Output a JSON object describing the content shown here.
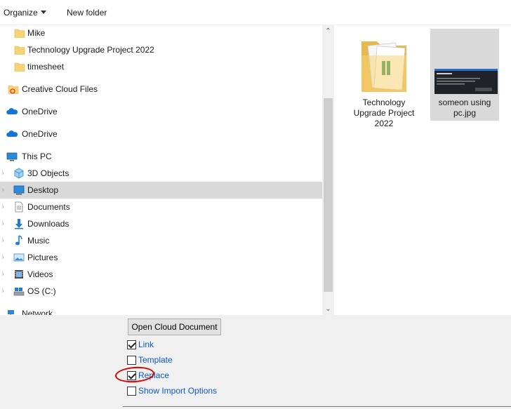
{
  "toolbar": {
    "organize_label": "Organize",
    "new_folder_label": "New folder"
  },
  "nav": {
    "items": [
      {
        "label": "Mike",
        "icon": "folder-icon"
      },
      {
        "label": "Technology Upgrade Project 2022",
        "icon": "folder-icon"
      },
      {
        "label": "timesheet",
        "icon": "folder-icon"
      },
      {
        "label": "Creative Cloud Files",
        "icon": "creative-cloud-icon"
      },
      {
        "label": "OneDrive",
        "icon": "onedrive-icon"
      },
      {
        "label": "OneDrive",
        "icon": "onedrive-icon"
      },
      {
        "label": "This PC",
        "icon": "computer-icon"
      },
      {
        "label": "3D Objects",
        "icon": "3d-objects-icon"
      },
      {
        "label": "Desktop",
        "icon": "desktop-icon",
        "selected": true
      },
      {
        "label": "Documents",
        "icon": "documents-icon"
      },
      {
        "label": "Downloads",
        "icon": "downloads-icon"
      },
      {
        "label": "Music",
        "icon": "music-icon"
      },
      {
        "label": "Pictures",
        "icon": "pictures-icon"
      },
      {
        "label": "Videos",
        "icon": "videos-icon"
      },
      {
        "label": "OS (C:)",
        "icon": "drive-icon"
      },
      {
        "label": "Network",
        "icon": "network-icon"
      }
    ]
  },
  "files": {
    "items": [
      {
        "name": "Technology Upgrade Project 2022",
        "icon": "folder-icon"
      },
      {
        "name": "someon using pc.jpg",
        "icon": "image-thumbnail",
        "selected": true
      }
    ]
  },
  "bottom": {
    "open_cloud_label": "Open Cloud Document",
    "options": [
      {
        "label": "Link",
        "checked": true
      },
      {
        "label": "Template",
        "checked": false
      },
      {
        "label": "Replace",
        "checked": true
      },
      {
        "label": "Show Import Options",
        "checked": false
      }
    ]
  },
  "colors": {
    "selection": "#d9d9d9",
    "link_text": "#0b57c9",
    "annotation": "#d90000",
    "folder": "#f6d374"
  }
}
